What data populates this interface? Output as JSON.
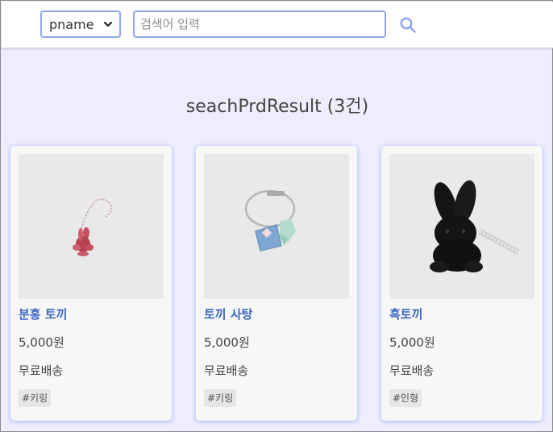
{
  "header": {
    "select_value": "pname",
    "search_placeholder": "검색어 입력"
  },
  "page_title": "seachPrdResult (3건)",
  "products": [
    {
      "name": "분홍 토끼",
      "price": "5,000원",
      "shipping": "무료배송",
      "tag": "#키링"
    },
    {
      "name": "토끼 사탕",
      "price": "5,000원",
      "shipping": "무료배송",
      "tag": "#키링"
    },
    {
      "name": "흑토끼",
      "price": "5,000원",
      "shipping": "무료배송",
      "tag": "#인형"
    }
  ],
  "colors": {
    "accent": "#8fa4f3",
    "link": "#3c67c0",
    "page_bg": "#ededfd"
  },
  "icons": {
    "search": "search-icon",
    "dropdown": "chevron-down-icon"
  }
}
